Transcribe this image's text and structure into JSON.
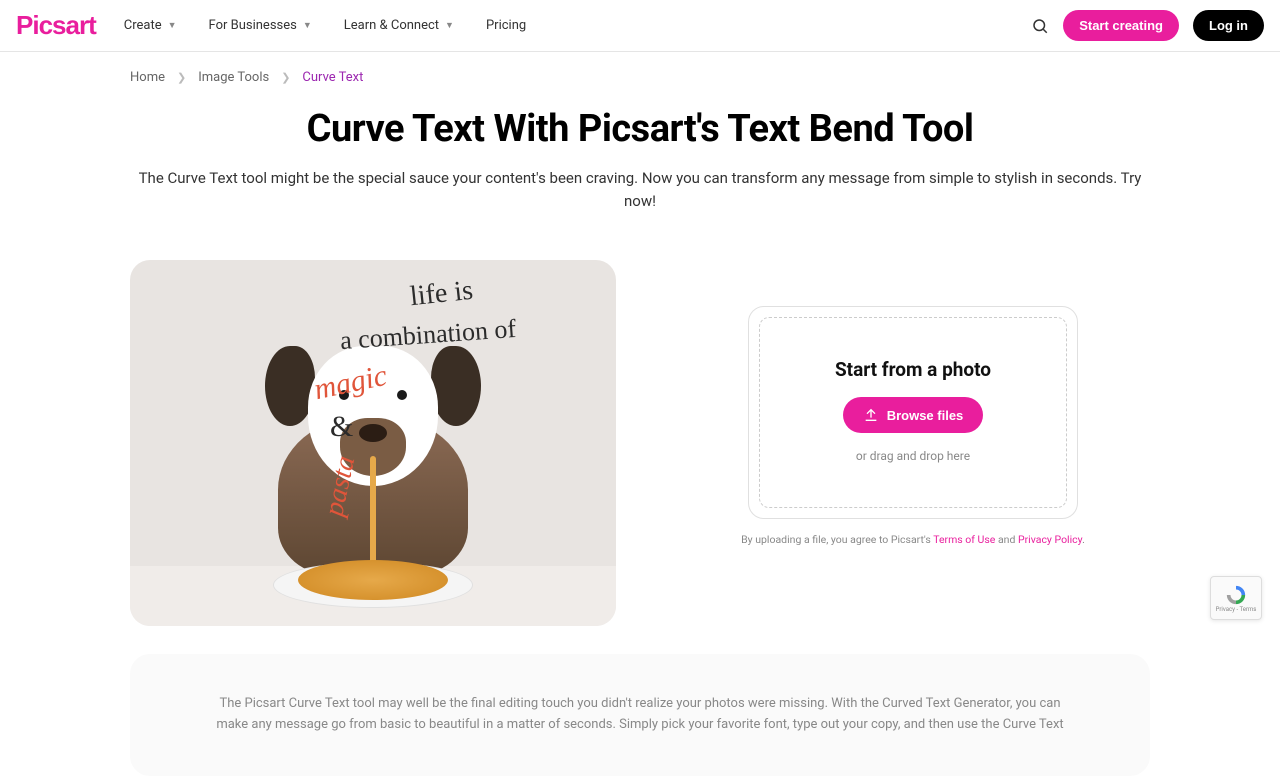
{
  "brand": "Picsart",
  "nav": {
    "create": "Create",
    "business": "For Businesses",
    "learn": "Learn & Connect",
    "pricing": "Pricing"
  },
  "header": {
    "start": "Start creating",
    "login": "Log in"
  },
  "breadcrumb": {
    "home": "Home",
    "tools": "Image Tools",
    "current": "Curve Text"
  },
  "hero": {
    "title": "Curve Text With Picsart's Text Bend Tool",
    "subtitle": "The Curve Text tool might be the special sauce your content's been craving. Now you can transform any message from simple to stylish in seconds. Try now!"
  },
  "hero_image": {
    "line1": "life is",
    "line2": "a combination of",
    "line3": "magic",
    "line4": "&",
    "line5": "pasta"
  },
  "upload": {
    "title": "Start from a photo",
    "browse": "Browse files",
    "drag": "or drag and drop here",
    "disclaimer_prefix": "By uploading a file, you agree to Picsart's ",
    "terms": "Terms of Use",
    "and": " and ",
    "privacy": "Privacy Policy",
    "period": "."
  },
  "body": {
    "text": "The Picsart Curve Text tool may well be the final editing touch you didn't realize your photos were missing. With the Curved Text Generator, you can make any message go from basic to beautiful in a matter of seconds. Simply pick your favorite font, type out your copy, and then use the Curve Text"
  },
  "recaptcha": {
    "label": "reCAPTCHA",
    "privacy": "Privacy - Terms"
  }
}
